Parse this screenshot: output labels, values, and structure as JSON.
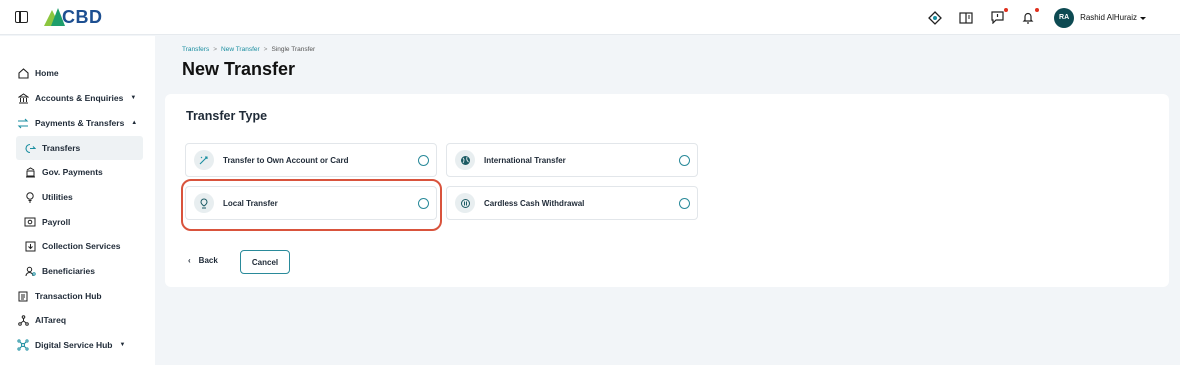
{
  "topbar": {
    "logo_text": "CBD",
    "user_initials": "RA",
    "user_name": "Rashid AlHuraiz",
    "icons": [
      "tag-icon",
      "book-icon",
      "message-icon",
      "bell-icon"
    ]
  },
  "sidebar": {
    "items": [
      {
        "label": "Home",
        "icon": "home-icon"
      },
      {
        "label": "Accounts & Enquiries",
        "icon": "bank-icon",
        "caret": "▼"
      },
      {
        "label": "Payments & Transfers",
        "icon": "transfer-icon",
        "caret": "▲"
      },
      {
        "label": "Transfers",
        "icon": "transfers-icon"
      },
      {
        "label": "Gov. Payments",
        "icon": "gov-icon"
      },
      {
        "label": "Utilities",
        "icon": "bulb-icon"
      },
      {
        "label": "Payroll",
        "icon": "payroll-icon"
      },
      {
        "label": "Collection Services",
        "icon": "collection-icon"
      },
      {
        "label": "Beneficiaries",
        "icon": "beneficiaries-icon"
      },
      {
        "label": "Transaction Hub",
        "icon": "hub-icon"
      },
      {
        "label": "AlTareq",
        "icon": "network-icon"
      },
      {
        "label": "Digital Service Hub",
        "icon": "digital-icon",
        "caret": "▼"
      }
    ]
  },
  "breadcrumb": {
    "items": [
      "Transfers",
      "New Transfer",
      "Single Transfer"
    ],
    "separator": ">"
  },
  "page_title": "New Transfer",
  "transfer_type": {
    "title": "Transfer Type",
    "options": [
      {
        "label": "Transfer to Own Account or Card",
        "icon": "own-account-icon"
      },
      {
        "label": "International Transfer",
        "icon": "globe-icon"
      },
      {
        "label": "Local Transfer",
        "icon": "local-transfer-icon"
      },
      {
        "label": "Cardless Cash Withdrawal",
        "icon": "cash-icon"
      }
    ]
  },
  "actions": {
    "back_label": "Back",
    "cancel_label": "Cancel"
  },
  "colors": {
    "accent": "#2a8a9a",
    "highlight": "#d9533c",
    "avatar": "#0d4a52",
    "notification_dot": "#e0301e"
  }
}
